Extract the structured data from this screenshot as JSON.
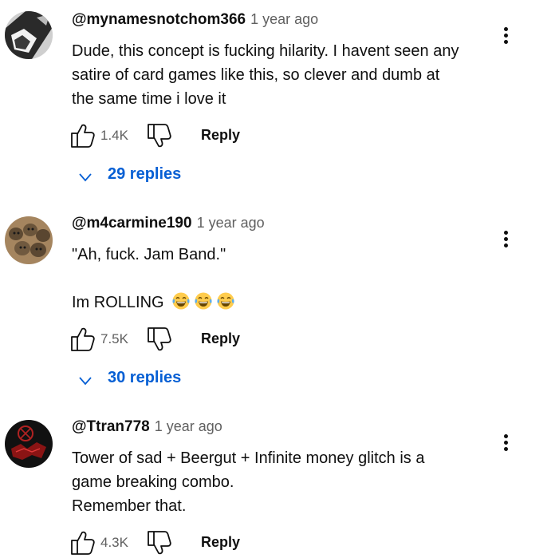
{
  "comments": [
    {
      "handle": "@mynamesnotchom366",
      "time": "1 year ago",
      "lines": [
        "Dude, this concept is fucking hilarity. I havent seen any",
        "satire of card games like this, so clever and dumb at",
        "the same time i love it"
      ],
      "likes": "1.4K",
      "reply_label": "Reply",
      "replies_label": "29 replies"
    },
    {
      "handle": "@m4carmine190",
      "time": "1 year ago",
      "line1": "\"Ah, fuck. Jam Band.\"",
      "line2": "Im ROLLING",
      "emoji": [
        "face-with-tears-of-joy-icon",
        "face-with-tears-of-joy-icon",
        "face-with-tears-of-joy-icon"
      ],
      "likes": "7.5K",
      "reply_label": "Reply",
      "replies_label": "30 replies"
    },
    {
      "handle": "@Ttran778",
      "time": "1 year ago",
      "lines": [
        "Tower of sad + Beergut + Infinite money glitch is a",
        "game breaking combo.",
        "Remember that."
      ],
      "likes": "4.3K",
      "reply_label": "Reply"
    }
  ],
  "colors": {
    "link_blue": "#065fd4",
    "meta_gray": "#606060",
    "text": "#0f0f0f"
  }
}
